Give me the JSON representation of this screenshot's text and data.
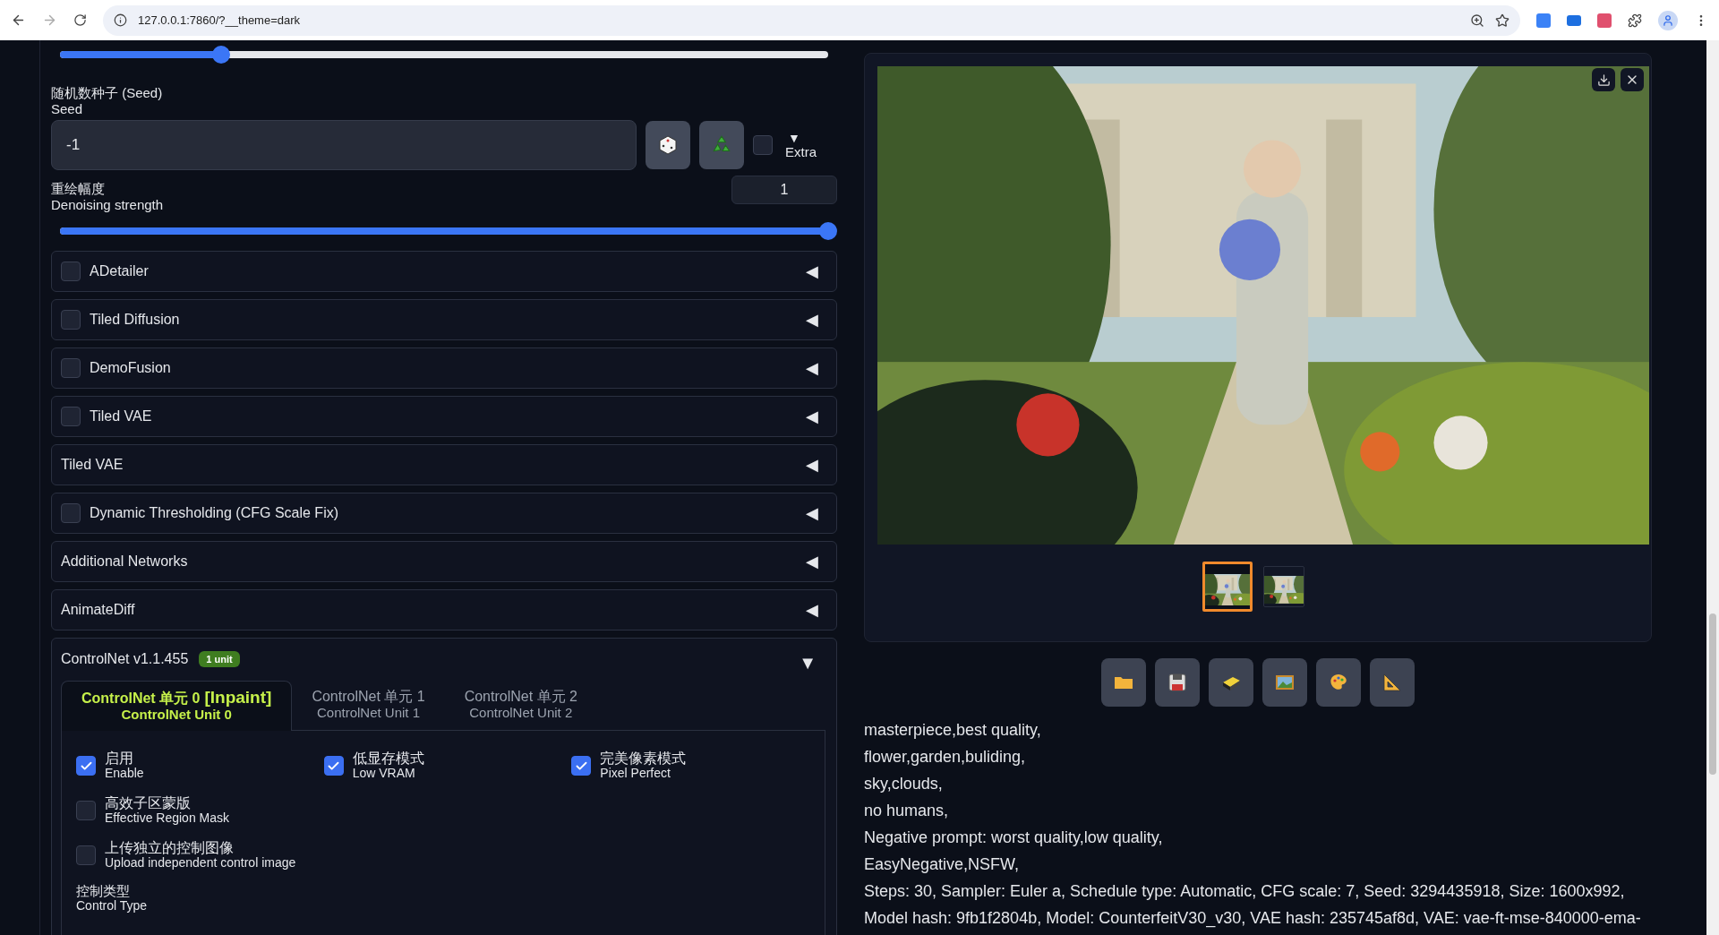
{
  "browser": {
    "url": "127.0.0.1:7860/?__theme=dark"
  },
  "top_slider": {
    "level": 0.21
  },
  "seed": {
    "label": "随机数种子 (Seed)",
    "sublabel": "Seed",
    "value": "-1",
    "extra_checked": false,
    "extra_label": "▼",
    "extra_text": "Extra"
  },
  "denoising": {
    "label": "重绘幅度",
    "sublabel": "Denoising strength",
    "value": "1",
    "level": 1.0
  },
  "accordions": [
    {
      "kind": "checkbox",
      "label": "ADetailer",
      "checked": false,
      "arrow": "◀"
    },
    {
      "kind": "checkbox",
      "label": "Tiled Diffusion",
      "checked": false,
      "arrow": "◀"
    },
    {
      "kind": "checkbox",
      "label": "DemoFusion",
      "checked": false,
      "arrow": "◀"
    },
    {
      "kind": "checkbox",
      "label": "Tiled VAE",
      "checked": false,
      "arrow": "◀"
    },
    {
      "kind": "plain",
      "label": "Tiled VAE",
      "arrow": "◀"
    },
    {
      "kind": "checkbox",
      "label": "Dynamic Thresholding (CFG Scale Fix)",
      "checked": false,
      "arrow": "◀"
    },
    {
      "kind": "plain",
      "label": "Additional Networks",
      "arrow": "◀"
    },
    {
      "kind": "plain",
      "label": "AnimateDiff",
      "arrow": "◀"
    }
  ],
  "controlnet": {
    "title": "ControlNet v1.1.455",
    "badge": "1 unit",
    "arrow": "▼",
    "tabs": [
      {
        "line1": "ControlNet 单元 0",
        "tag": "[Inpaint]",
        "line2": "ControlNet Unit 0",
        "selected": true
      },
      {
        "line1": "ControlNet 单元 1",
        "line2": "ControlNet Unit 1",
        "selected": false
      },
      {
        "line1": "ControlNet 单元 2",
        "line2": "ControlNet Unit 2",
        "selected": false
      }
    ],
    "options": [
      {
        "label": "启用",
        "sublabel": "Enable",
        "checked": true
      },
      {
        "label": "低显存模式",
        "sublabel": "Low VRAM",
        "checked": true
      },
      {
        "label": "完美像素模式",
        "sublabel": "Pixel Perfect",
        "checked": true
      },
      {
        "label": "高效子区蒙版",
        "sublabel": "Effective Region Mask",
        "checked": false
      },
      {
        "label": "上传独立的控制图像",
        "sublabel": "Upload independent control image",
        "checked": false
      }
    ],
    "control_type": {
      "label": "控制类型",
      "sublabel": "Control Type"
    }
  },
  "gallery": {
    "thumbnails": [
      {
        "selected": true
      },
      {
        "selected": false
      }
    ]
  },
  "info_lines": [
    "masterpiece,best quality,",
    "flower,garden,buliding,",
    "sky,clouds,",
    "no humans,",
    "Negative prompt: worst quality,low quality,",
    "EasyNegative,NSFW,",
    "Steps: 30, Sampler: Euler a, Schedule type: Automatic, CFG scale: 7, Seed: 3294435918, Size: 1600x992,",
    "Model hash: 9fb1f2804b, Model: CounterfeitV30_v30, VAE hash: 235745af8d, VAE: vae-ft-mse-840000-ema-"
  ]
}
